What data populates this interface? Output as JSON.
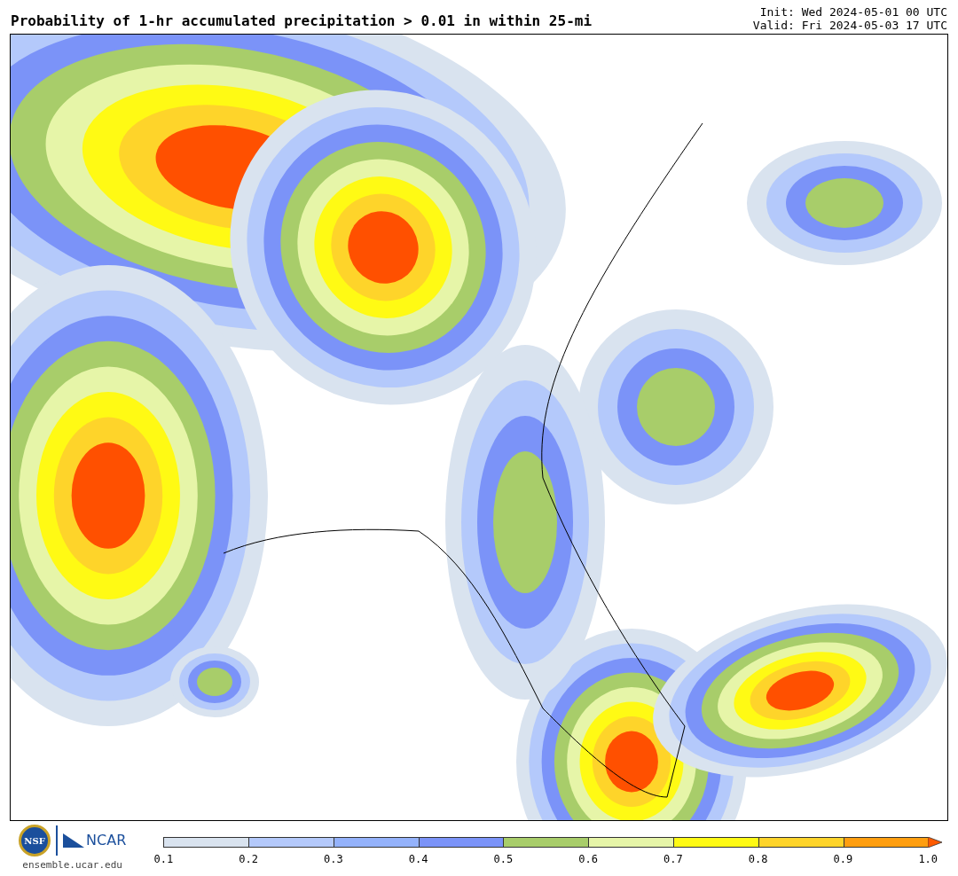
{
  "title": "Probability of 1-hr accumulated precipitation > 0.01 in within 25-mi",
  "init": "Init: Wed 2024-05-01 00 UTC",
  "valid": "Valid: Fri 2024-05-03 17 UTC",
  "logos": {
    "nsf": "NSF",
    "ncar": "NCAR",
    "site": "ensemble.ucar.edu"
  },
  "colorbar": {
    "bins": [
      {
        "color": "#d9e3ef"
      },
      {
        "color": "#b4c9fb"
      },
      {
        "color": "#94b2fb"
      },
      {
        "color": "#7b93f8"
      },
      {
        "color": "#a8cd6a"
      },
      {
        "color": "#e6f5a8"
      },
      {
        "color": "#fffa14"
      },
      {
        "color": "#fed42a"
      },
      {
        "color": "#ff9e10"
      }
    ],
    "ticks": [
      "0.1",
      "0.2",
      "0.3",
      "0.4",
      "0.5",
      "0.6",
      "0.7",
      "0.8",
      "0.9",
      "1.0"
    ],
    "extend_arrow": {
      "color": "#ff5a00"
    }
  }
}
